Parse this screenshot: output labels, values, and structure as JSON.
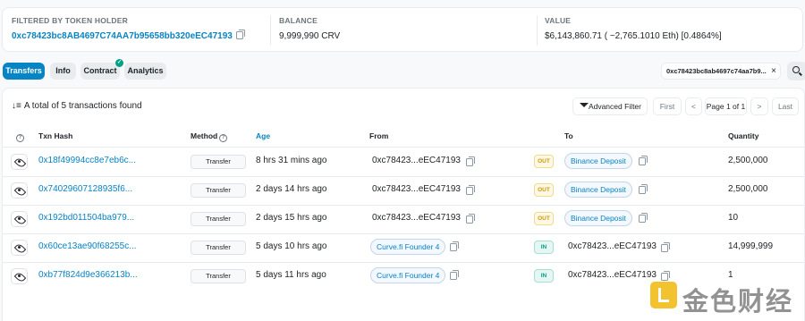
{
  "summary": {
    "filter_label": "FILTERED BY TOKEN HOLDER",
    "filter_address": "0xc78423bc8AB4697C74AA7b95658bb320eEC47193",
    "balance_label": "BALANCE",
    "balance_value": "9,999,990 CRV",
    "value_label": "VALUE",
    "value_value": "$6,143,860.71 ( ~2,765.1010 Eth) [0.4864%]"
  },
  "tabs": [
    {
      "label": "Transfers",
      "active": true
    },
    {
      "label": "Info",
      "active": false
    },
    {
      "label": "Contract",
      "active": false,
      "verified": true
    },
    {
      "label": "Analytics",
      "active": false
    }
  ],
  "filter_chip": {
    "text": "0xc78423bc8ab4697c74aa7b9...",
    "close": "×"
  },
  "toolbar": {
    "total_text": "A total of 5 transactions found",
    "advanced_filter": "Advanced Filter",
    "first": "First",
    "prev": "<",
    "page_info": "Page 1 of 1",
    "next": ">",
    "last": "Last"
  },
  "table": {
    "headers": {
      "txn_hash": "Txn Hash",
      "method": "Method",
      "age": "Age",
      "from": "From",
      "to": "To",
      "quantity": "Quantity"
    },
    "rows": [
      {
        "hash": "0x18f49994cc8e7eb6c...",
        "method": "Transfer",
        "age": "8 hrs 31 mins ago",
        "from": "0xc78423...eEC47193",
        "from_is_label": false,
        "direction": "OUT",
        "to": "Binance Deposit",
        "to_is_label": true,
        "quantity": "2,500,000"
      },
      {
        "hash": "0x74029607128935f6...",
        "method": "Transfer",
        "age": "2 days 14 hrs ago",
        "from": "0xc78423...eEC47193",
        "from_is_label": false,
        "direction": "OUT",
        "to": "Binance Deposit",
        "to_is_label": true,
        "quantity": "2,500,000"
      },
      {
        "hash": "0x192bd011504ba979...",
        "method": "Transfer",
        "age": "2 days 15 hrs ago",
        "from": "0xc78423...eEC47193",
        "from_is_label": false,
        "direction": "OUT",
        "to": "Binance Deposit",
        "to_is_label": true,
        "quantity": "10"
      },
      {
        "hash": "0x60ce13ae90f68255c...",
        "method": "Transfer",
        "age": "5 days 10 hrs ago",
        "from": "Curve.fi Founder 4",
        "from_is_label": true,
        "direction": "IN",
        "to": "0xc78423...eEC47193",
        "to_is_label": false,
        "quantity": "14,999,999"
      },
      {
        "hash": "0xb77f824d9e366213b...",
        "method": "Transfer",
        "age": "5 days 11 hrs ago",
        "from": "Curve.fi Founder 4",
        "from_is_label": true,
        "direction": "IN",
        "to": "0xc78423...eEC47193",
        "to_is_label": false,
        "quantity": "1"
      }
    ]
  },
  "watermark": {
    "text": "金色财经"
  },
  "colors": {
    "accent": "#0784c3",
    "out": "#cc9a06",
    "in": "#00a186"
  }
}
